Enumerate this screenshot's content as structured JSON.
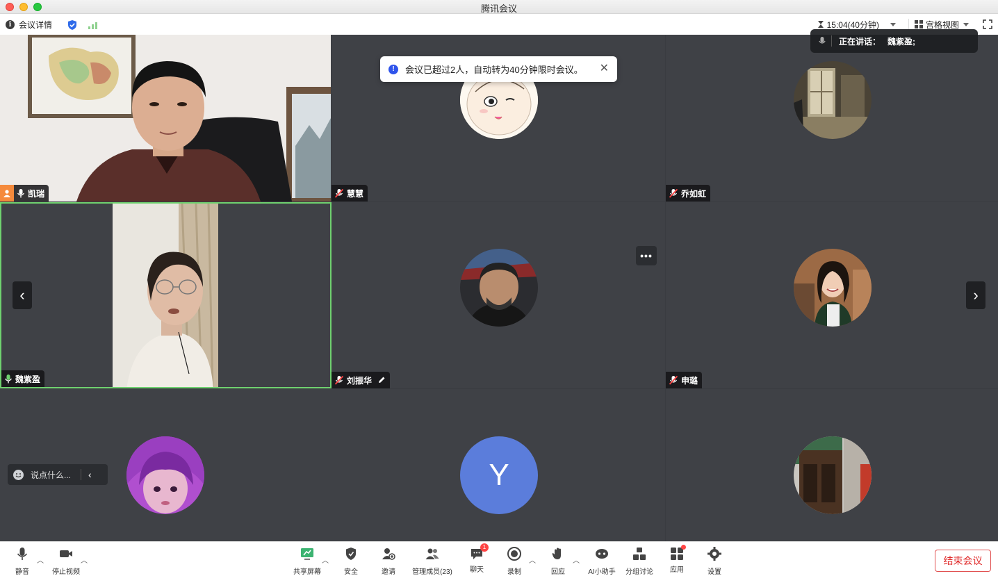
{
  "window": {
    "title": "腾讯会议"
  },
  "infobar": {
    "meeting_info_label": "会议详情",
    "timer": "15:04(40分钟)",
    "view_mode": "宫格视图"
  },
  "toast": {
    "message": "会议已超过2人，自动转为40分钟限时会议。"
  },
  "speaking": {
    "label": "正在讲话：",
    "name": "魏紫盈;"
  },
  "participants": [
    {
      "name": "凯瑞",
      "video": true,
      "host": true,
      "mic": "on"
    },
    {
      "name": "慧慧",
      "video": false,
      "mic": "muted"
    },
    {
      "name": "乔如虹",
      "video": false,
      "mic": "muted"
    },
    {
      "name": "魏紫盈",
      "video": true,
      "mic": "speaking"
    },
    {
      "name": "刘振华",
      "video": false,
      "mic": "muted",
      "editing": true
    },
    {
      "name": "申璐",
      "video": false,
      "mic": "muted"
    },
    {
      "name": "",
      "video": false
    },
    {
      "name": "",
      "video": false,
      "initial": "Y"
    },
    {
      "name": "",
      "video": false
    }
  ],
  "chat_input": {
    "placeholder": "说点什么..."
  },
  "toolbar": {
    "mute": "静音",
    "stop_video": "停止视频",
    "share_screen": "共享屏幕",
    "security": "安全",
    "invite": "邀请",
    "manage_members": "管理成员(23)",
    "chat": "聊天",
    "chat_badge": "1",
    "record": "录制",
    "reactions": "回应",
    "ai_assistant": "AI小助手",
    "breakout": "分组讨论",
    "apps": "应用",
    "settings": "设置",
    "end_meeting": "结束会议"
  },
  "colors": {
    "accent": "#2f54eb",
    "active_speaker_border": "#6fd16f",
    "end_button": "#e02a2a",
    "avatar_y": "#5b7ddb",
    "stage_bg": "#3f4146"
  }
}
